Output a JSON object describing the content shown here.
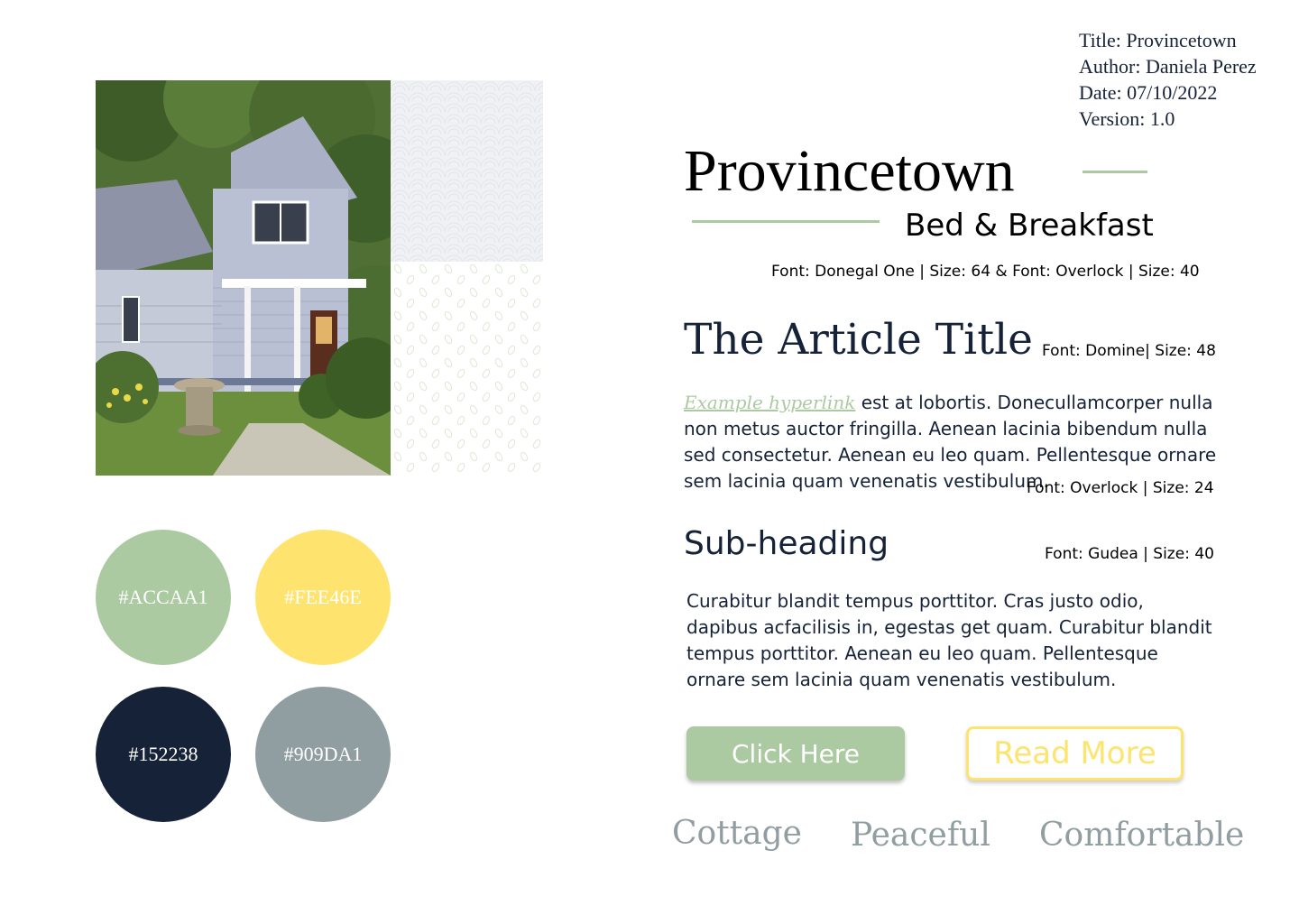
{
  "meta": {
    "title": "Title: Provincetown",
    "author": "Author: Daniela Perez",
    "date": "Date: 07/10/2022",
    "version": "Version: 1.0"
  },
  "brand": {
    "name": "Provincetown",
    "tagline": "Bed & Breakfast",
    "font_note": "Font: Donegal One | Size: 64 & Font: Overlock | Size: 40"
  },
  "swatches": [
    {
      "label": "#ACCAA1",
      "color": "#ACCAA1"
    },
    {
      "label": "#FEE46E",
      "color": "#FEE46E"
    },
    {
      "label": "#152238",
      "color": "#152238"
    },
    {
      "label": "#909DA1",
      "color": "#909DA1"
    }
  ],
  "article": {
    "title": "The Article Title",
    "title_font_note": "Font: Domine| Size: 48",
    "hyperlink": "Example hyperlink",
    "paragraph_rest": " est at lobortis. Donecullamcorper nulla non metus auctor fringilla. Aenean lacinia bibendum nulla sed consectetur. Aenean eu leo quam. Pellentesque ornare sem lacinia quam venenatis vestibulum.",
    "paragraph_font_note": "Font: Overlock | Size: 24",
    "subheading": "Sub-heading",
    "subheading_font_note": "Font: Gudea | Size: 40",
    "paragraph2": "Curabitur blandit tempus porttitor. Cras justo odio, dapibus acfacilisis in, egestas get quam. Curabitur blandit tempus porttitor. Aenean eu leo quam. Pellentesque ornare sem lacinia quam venenatis vestibulum."
  },
  "buttons": {
    "primary": "Click Here",
    "secondary": "Read More"
  },
  "keywords": [
    "Cottage",
    "Peaceful",
    "Comfortable"
  ],
  "colors": {
    "accent_green": "#ACCAA1",
    "accent_yellow": "#FEE46E",
    "navy": "#152238",
    "gray": "#909DA1"
  }
}
